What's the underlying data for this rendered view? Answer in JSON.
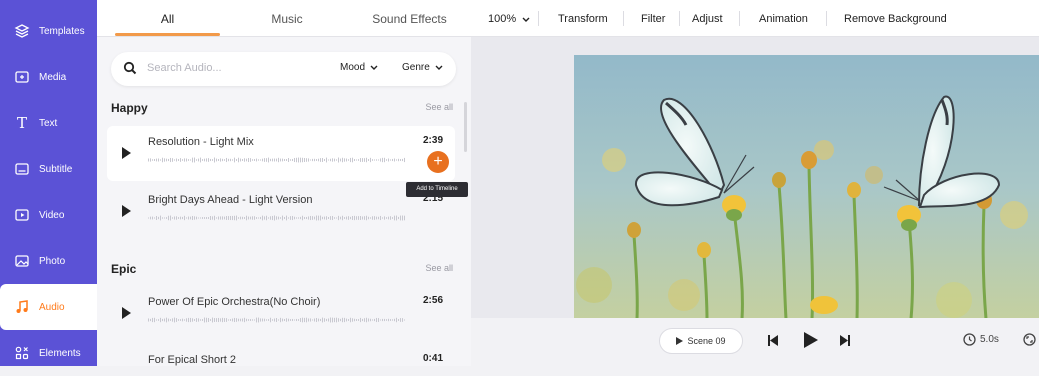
{
  "sidebar": {
    "items": [
      {
        "label": "Templates",
        "icon": "layers-icon"
      },
      {
        "label": "Media",
        "icon": "folder-icon"
      },
      {
        "label": "Text",
        "icon": "text-icon"
      },
      {
        "label": "Subtitle",
        "icon": "subtitle-icon"
      },
      {
        "label": "Video",
        "icon": "video-icon"
      },
      {
        "label": "Photo",
        "icon": "image-icon"
      },
      {
        "label": "Audio",
        "icon": "music-note-icon",
        "active": true
      },
      {
        "label": "Elements",
        "icon": "elements-icon"
      }
    ]
  },
  "audio_panel": {
    "tabs": [
      {
        "label": "All",
        "active": true
      },
      {
        "label": "Music"
      },
      {
        "label": "Sound Effects"
      }
    ],
    "search": {
      "placeholder": "Search Audio...",
      "mood_label": "Mood",
      "genre_label": "Genre"
    },
    "sections": [
      {
        "title": "Happy",
        "see_all": "See all",
        "tracks": [
          {
            "title": "Resolution - Light Mix",
            "duration": "2:39"
          },
          {
            "title": "Bright Days Ahead - Light Version",
            "duration": "2:15"
          }
        ]
      },
      {
        "title": "Epic",
        "see_all": "See all",
        "tracks": [
          {
            "title": "Power Of Epic Orchestra(No Choir)",
            "duration": "2:56"
          },
          {
            "title": "For Epical Short 2",
            "duration": "0:41"
          }
        ]
      }
    ],
    "add_button": "+",
    "tooltip": "Add to Timeline"
  },
  "toolbar": {
    "zoom": "100%",
    "items": [
      "Transform",
      "Filter",
      "Adjust",
      "Animation",
      "Remove Background"
    ]
  },
  "playback": {
    "scene_label": "Scene 09",
    "duration": "5.0s"
  },
  "colors": {
    "sidebar_bg": "#5b52d6",
    "accent_orange": "#e8701f",
    "tab_underline": "#f29a4a"
  }
}
